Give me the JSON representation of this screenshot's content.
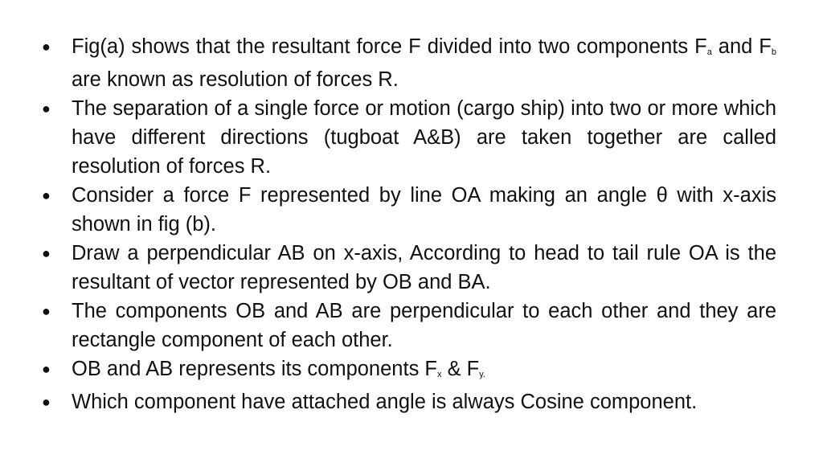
{
  "bullet_glyph": "●",
  "bullets": [
    {
      "parts": [
        "Fig(a) shows that the resultant force F divided into two components F",
        "a",
        " and F",
        "b",
        "  are known as resolution of forces R."
      ]
    },
    {
      "text": "The separation of a single force or motion (cargo ship) into two or more which have different directions (tugboat A&B) are taken together are called resolution of forces R."
    },
    {
      "text": "Consider a force F represented by line OA making an angle θ with x-axis shown in fig (b)."
    },
    {
      "text": "Draw a perpendicular AB on x-axis, According to head to tail rule OA is the resultant of vector represented by OB and BA."
    },
    {
      "text": "The components OB and AB are perpendicular to each other and they are rectangle component of each other."
    },
    {
      "parts": [
        "OB and AB represents its components F",
        "x",
        " & F",
        "y."
      ]
    },
    {
      "text": "Which component have attached angle is always Cosine component."
    }
  ]
}
